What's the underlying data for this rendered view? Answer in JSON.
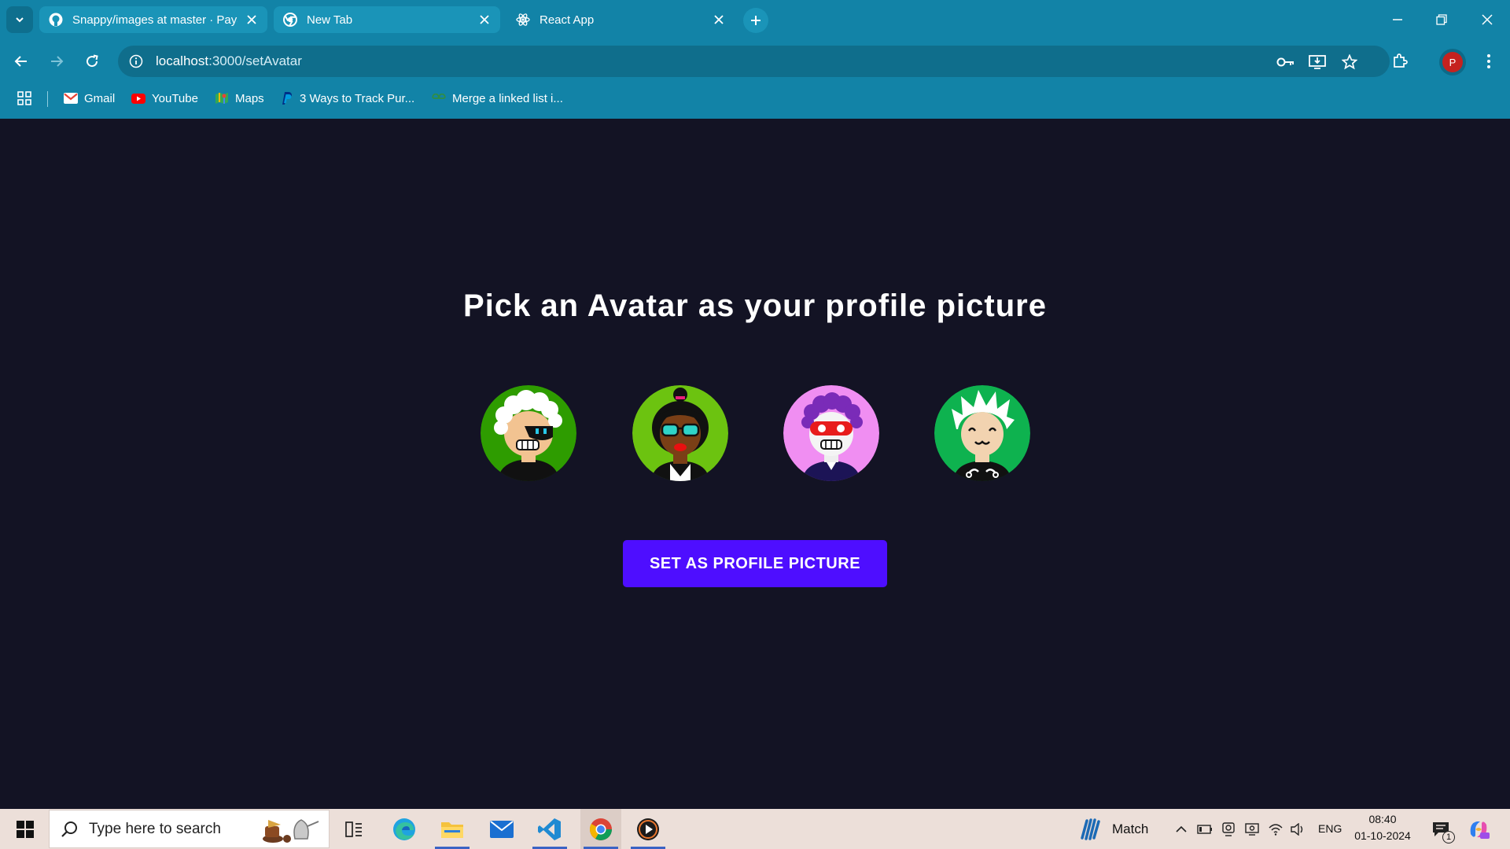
{
  "browser": {
    "tabs": [
      {
        "title": "Snappy/images at master · Paya",
        "icon": "github-icon",
        "active": false
      },
      {
        "title": "New Tab",
        "icon": "chrome-icon",
        "active": false
      },
      {
        "title": "React App",
        "icon": "react-icon",
        "active": true
      }
    ],
    "url": {
      "host": "localhost",
      "path": ":3000/setAvatar"
    },
    "profile_initial": "P",
    "bookmarks": [
      {
        "label": "Gmail",
        "icon": "gmail-icon"
      },
      {
        "label": "YouTube",
        "icon": "youtube-icon"
      },
      {
        "label": "Maps",
        "icon": "maps-icon"
      },
      {
        "label": "3 Ways to Track Pur...",
        "icon": "paypal-icon"
      },
      {
        "label": "Merge a linked list i...",
        "icon": "gfg-icon"
      }
    ]
  },
  "page": {
    "title": "Pick an Avatar as your profile picture",
    "button_label": "SET AS PROFILE PICTURE",
    "avatars": [
      {
        "name": "avatar-white-hair-eyepatch",
        "bg": "#2e9c00"
      },
      {
        "name": "avatar-sunglasses-bun",
        "bg": "#6cc310"
      },
      {
        "name": "avatar-red-mask",
        "bg": "#f08ef2"
      },
      {
        "name": "avatar-white-spiky-hair",
        "bg": "#0eb24f"
      }
    ],
    "colors": {
      "background": "#131324",
      "button": "#4e0eff"
    }
  },
  "taskbar": {
    "search_placeholder": "Type here to search",
    "weather_label": "Match",
    "language": "ENG",
    "time": "08:40",
    "date": "01-10-2024",
    "notifications": "1"
  }
}
